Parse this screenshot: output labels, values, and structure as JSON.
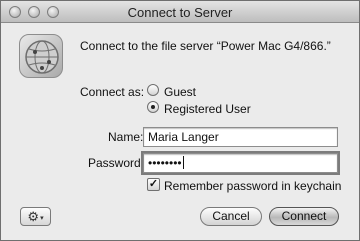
{
  "window": {
    "title": "Connect to Server"
  },
  "prompt": "Connect to the file server “Power Mac G4/866.”",
  "connect_as": {
    "label": "Connect as:",
    "options": [
      {
        "label": "Guest",
        "selected": false
      },
      {
        "label": "Registered User",
        "selected": true
      }
    ]
  },
  "name": {
    "label": "Name:",
    "value": "Maria Langer"
  },
  "password": {
    "label": "Password:",
    "value": "••••••••"
  },
  "remember": {
    "label": "Remember password in keychain",
    "checked": true,
    "mark": "✓"
  },
  "buttons": {
    "gear": "⚙",
    "gear_arrow": "▾",
    "cancel": "Cancel",
    "connect": "Connect"
  },
  "icons": {
    "server": "network-server-icon",
    "gear": "gear-icon"
  }
}
